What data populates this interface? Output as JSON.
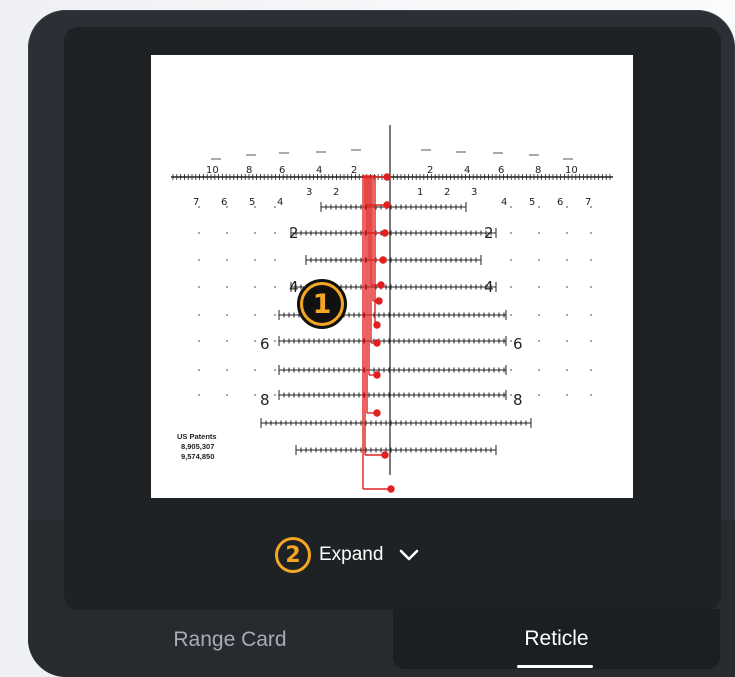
{
  "reticle": {
    "top_scale_labels": [
      "10",
      "8",
      "6",
      "4",
      "2",
      "2",
      "4",
      "6",
      "8",
      "10"
    ],
    "lower_scale_labels": [
      "7",
      "6",
      "5",
      "4",
      "3",
      "2",
      "1",
      "2",
      "3",
      "4",
      "5",
      "6",
      "7"
    ],
    "row_labels": [
      "2",
      "4",
      "6",
      "8",
      "2",
      "4",
      "6",
      "8"
    ],
    "patent_line1": "US Patents",
    "patent_line2": "8,905,307",
    "patent_line3": "9,574,850"
  },
  "callouts": {
    "one": "1",
    "two": "2"
  },
  "expand": {
    "label": "Expand",
    "icon": "chevron-down-icon"
  },
  "tabs": [
    {
      "label": "Range Card",
      "active": false
    },
    {
      "label": "Reticle",
      "active": true
    }
  ],
  "colors": {
    "accent": "#f5a623",
    "reticle_red": "#e02020",
    "panel": "#1f2224"
  }
}
